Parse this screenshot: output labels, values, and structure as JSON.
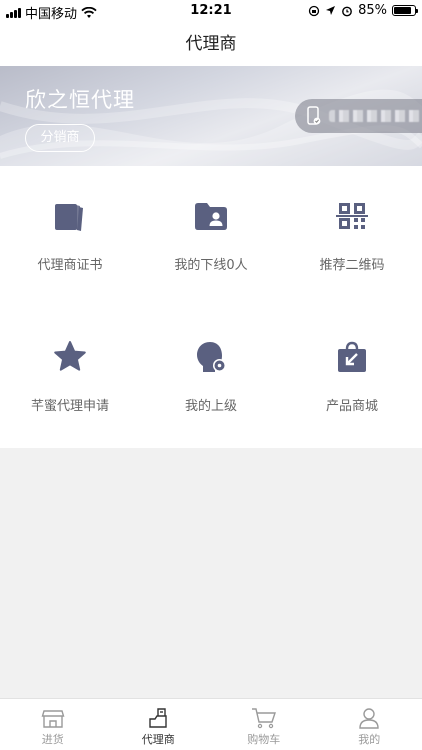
{
  "status_bar": {
    "carrier": "中国移动",
    "time": "12:21",
    "battery": "85%",
    "battery_level": 0.85
  },
  "nav": {
    "title": "代理商"
  },
  "banner": {
    "agent_name": "欣之恒代理",
    "badge_label": "分销商",
    "phone_icon": "phone-verified-icon"
  },
  "features": [
    {
      "label": "代理商证书",
      "icon": "certificate-icon"
    },
    {
      "label": "我的下线0人",
      "icon": "user-folder-icon"
    },
    {
      "label": "推荐二维码",
      "icon": "qrcode-icon"
    },
    {
      "label": "芊蜜代理申请",
      "icon": "star-icon"
    },
    {
      "label": "我的上级",
      "icon": "user-settings-icon"
    },
    {
      "label": "产品商城",
      "icon": "shopping-bag-icon"
    }
  ],
  "tabbar": {
    "items": [
      {
        "label": "进货",
        "icon": "store-icon",
        "active": false
      },
      {
        "label": "代理商",
        "icon": "agent-icon",
        "active": true
      },
      {
        "label": "购物车",
        "icon": "cart-icon",
        "active": false
      },
      {
        "label": "我的",
        "icon": "profile-icon",
        "active": false
      }
    ]
  },
  "colors": {
    "icon": "#5a6080",
    "text_muted": "#666666",
    "tab_active": "#333333",
    "tab_inactive": "#9a9a9a"
  }
}
